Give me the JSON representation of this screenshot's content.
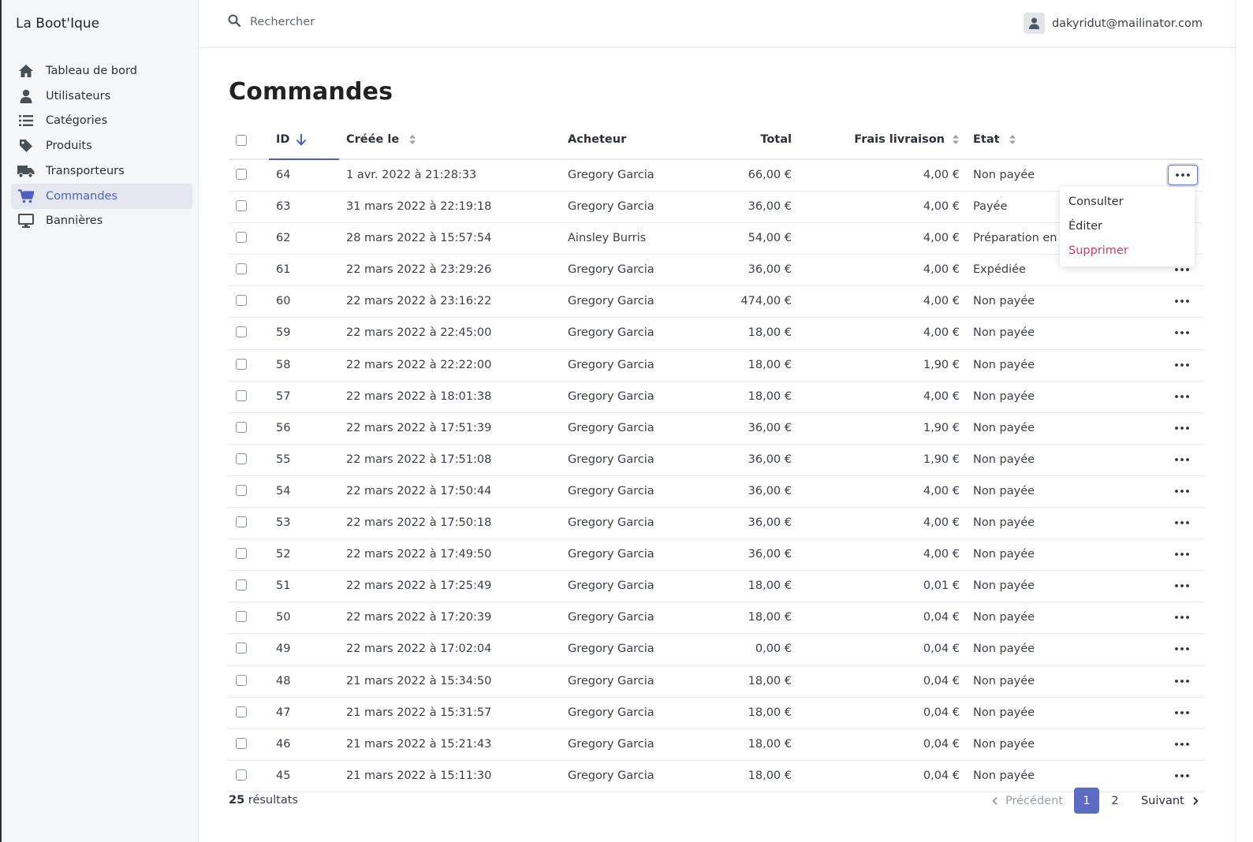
{
  "brand": "La Boot'Ique",
  "sidebar": {
    "items": [
      {
        "label": "Tableau de bord",
        "icon": "home-icon"
      },
      {
        "label": "Utilisateurs",
        "icon": "user-icon"
      },
      {
        "label": "Catégories",
        "icon": "list-icon"
      },
      {
        "label": "Produits",
        "icon": "tag-icon"
      },
      {
        "label": "Transporteurs",
        "icon": "truck-icon"
      },
      {
        "label": "Commandes",
        "icon": "cart-icon",
        "active": true
      },
      {
        "label": "Bannières",
        "icon": "monitor-icon"
      }
    ]
  },
  "search": {
    "placeholder": "Rechercher"
  },
  "user": {
    "email": "dakyridut@mailinator.com"
  },
  "page": {
    "title": "Commandes"
  },
  "table": {
    "headers": {
      "id": "ID",
      "created": "Créée le",
      "buyer": "Acheteur",
      "total": "Total",
      "shipping": "Frais livraison",
      "state": "Etat"
    },
    "rows": [
      {
        "id": "64",
        "created": "1 avr. 2022 à 21:28:33",
        "buyer": "Gregory Garcia",
        "total": "66,00 €",
        "shipping": "4,00 €",
        "state": "Non payée"
      },
      {
        "id": "63",
        "created": "31 mars 2022 à 22:19:18",
        "buyer": "Gregory Garcia",
        "total": "36,00 €",
        "shipping": "4,00 €",
        "state": "Payée"
      },
      {
        "id": "62",
        "created": "28 mars 2022 à 15:57:54",
        "buyer": "Ainsley Burris",
        "total": "54,00 €",
        "shipping": "4,00 €",
        "state": "Préparation en c"
      },
      {
        "id": "61",
        "created": "22 mars 2022 à 23:29:26",
        "buyer": "Gregory Garcia",
        "total": "36,00 €",
        "shipping": "4,00 €",
        "state": "Expédiée"
      },
      {
        "id": "60",
        "created": "22 mars 2022 à 23:16:22",
        "buyer": "Gregory Garcia",
        "total": "474,00 €",
        "shipping": "4,00 €",
        "state": "Non payée"
      },
      {
        "id": "59",
        "created": "22 mars 2022 à 22:45:00",
        "buyer": "Gregory Garcia",
        "total": "18,00 €",
        "shipping": "4,00 €",
        "state": "Non payée"
      },
      {
        "id": "58",
        "created": "22 mars 2022 à 22:22:00",
        "buyer": "Gregory Garcia",
        "total": "18,00 €",
        "shipping": "1,90 €",
        "state": "Non payée"
      },
      {
        "id": "57",
        "created": "22 mars 2022 à 18:01:38",
        "buyer": "Gregory Garcia",
        "total": "18,00 €",
        "shipping": "4,00 €",
        "state": "Non payée"
      },
      {
        "id": "56",
        "created": "22 mars 2022 à 17:51:39",
        "buyer": "Gregory Garcia",
        "total": "36,00 €",
        "shipping": "1,90 €",
        "state": "Non payée"
      },
      {
        "id": "55",
        "created": "22 mars 2022 à 17:51:08",
        "buyer": "Gregory Garcia",
        "total": "36,00 €",
        "shipping": "1,90 €",
        "state": "Non payée"
      },
      {
        "id": "54",
        "created": "22 mars 2022 à 17:50:44",
        "buyer": "Gregory Garcia",
        "total": "36,00 €",
        "shipping": "4,00 €",
        "state": "Non payée"
      },
      {
        "id": "53",
        "created": "22 mars 2022 à 17:50:18",
        "buyer": "Gregory Garcia",
        "total": "36,00 €",
        "shipping": "4,00 €",
        "state": "Non payée"
      },
      {
        "id": "52",
        "created": "22 mars 2022 à 17:49:50",
        "buyer": "Gregory Garcia",
        "total": "36,00 €",
        "shipping": "4,00 €",
        "state": "Non payée"
      },
      {
        "id": "51",
        "created": "22 mars 2022 à 17:25:49",
        "buyer": "Gregory Garcia",
        "total": "18,00 €",
        "shipping": "0,01 €",
        "state": "Non payée"
      },
      {
        "id": "50",
        "created": "22 mars 2022 à 17:20:39",
        "buyer": "Gregory Garcia",
        "total": "18,00 €",
        "shipping": "0,04 €",
        "state": "Non payée"
      },
      {
        "id": "49",
        "created": "22 mars 2022 à 17:02:04",
        "buyer": "Gregory Garcia",
        "total": "0,00 €",
        "shipping": "0,04 €",
        "state": "Non payée"
      },
      {
        "id": "48",
        "created": "21 mars 2022 à 15:34:50",
        "buyer": "Gregory Garcia",
        "total": "18,00 €",
        "shipping": "0,04 €",
        "state": "Non payée"
      },
      {
        "id": "47",
        "created": "21 mars 2022 à 15:31:57",
        "buyer": "Gregory Garcia",
        "total": "18,00 €",
        "shipping": "0,04 €",
        "state": "Non payée"
      },
      {
        "id": "46",
        "created": "21 mars 2022 à 15:21:43",
        "buyer": "Gregory Garcia",
        "total": "18,00 €",
        "shipping": "0,04 €",
        "state": "Non payée"
      },
      {
        "id": "45",
        "created": "21 mars 2022 à 15:11:30",
        "buyer": "Gregory Garcia",
        "total": "18,00 €",
        "shipping": "0,04 €",
        "state": "Non payée"
      }
    ]
  },
  "row_menu": {
    "consult": "Consulter",
    "edit": "Éditer",
    "delete": "Supprimer"
  },
  "footer": {
    "results_count": "25",
    "results_label": "résultats",
    "prev_label": "Précédent",
    "next_label": "Suivant",
    "pages": [
      "1",
      "2"
    ],
    "current_page": "1"
  },
  "colors": {
    "accent": "#5b6bc6",
    "danger": "#d33a5e",
    "sidebar_bg": "#f5f6f8"
  }
}
